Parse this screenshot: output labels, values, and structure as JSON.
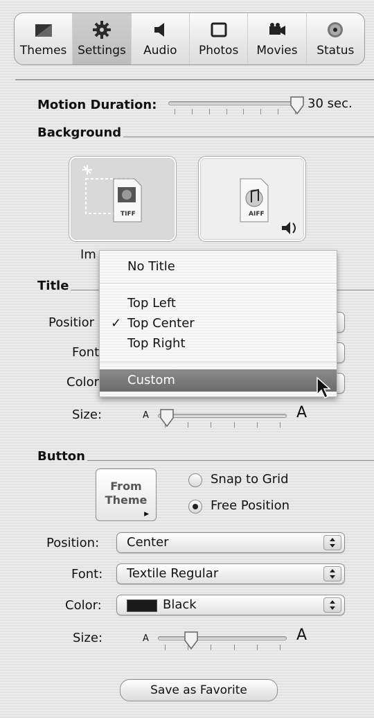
{
  "toolbar": {
    "tabs": [
      {
        "label": "Themes",
        "icon": "themes-icon"
      },
      {
        "label": "Settings",
        "icon": "gear-icon"
      },
      {
        "label": "Audio",
        "icon": "speaker-icon"
      },
      {
        "label": "Photos",
        "icon": "photo-frame-icon"
      },
      {
        "label": "Movies",
        "icon": "movie-camera-icon"
      },
      {
        "label": "Status",
        "icon": "status-disc-icon"
      }
    ]
  },
  "motion": {
    "label": "Motion Duration:",
    "value": "30 sec.",
    "fraction": 0.93
  },
  "background": {
    "heading": "Background",
    "image_label": "Im",
    "tiff_badge": "TIFF",
    "aiff_badge": "AIFF"
  },
  "title_section": {
    "heading": "Title",
    "position_label": "Positior",
    "font_label": "Font",
    "color_label": "Color",
    "size_label": "Size:",
    "size_small": "A",
    "size_large": "A",
    "size_fraction": 0.05
  },
  "title_menu": {
    "items": [
      "No Title",
      "Top Left",
      "Top Center",
      "Top Right",
      "Custom"
    ],
    "checked": "Top Center",
    "highlighted": "Custom",
    "check_mark": "✓"
  },
  "button_section": {
    "heading": "Button",
    "from_theme_line1": "From",
    "from_theme_line2": "Theme",
    "snap_label": "Snap to Grid",
    "free_label": "Free Position",
    "selected_option": "Free Position",
    "position_label": "Position:",
    "position_value": "Center",
    "font_label": "Font:",
    "font_value": "Textile Regular",
    "color_label": "Color:",
    "color_value": "Black",
    "color_swatch": "#1a1a1a",
    "size_label": "Size:",
    "size_small": "A",
    "size_large": "A",
    "size_fraction": 0.25
  },
  "save_label": "Save as Favorite"
}
